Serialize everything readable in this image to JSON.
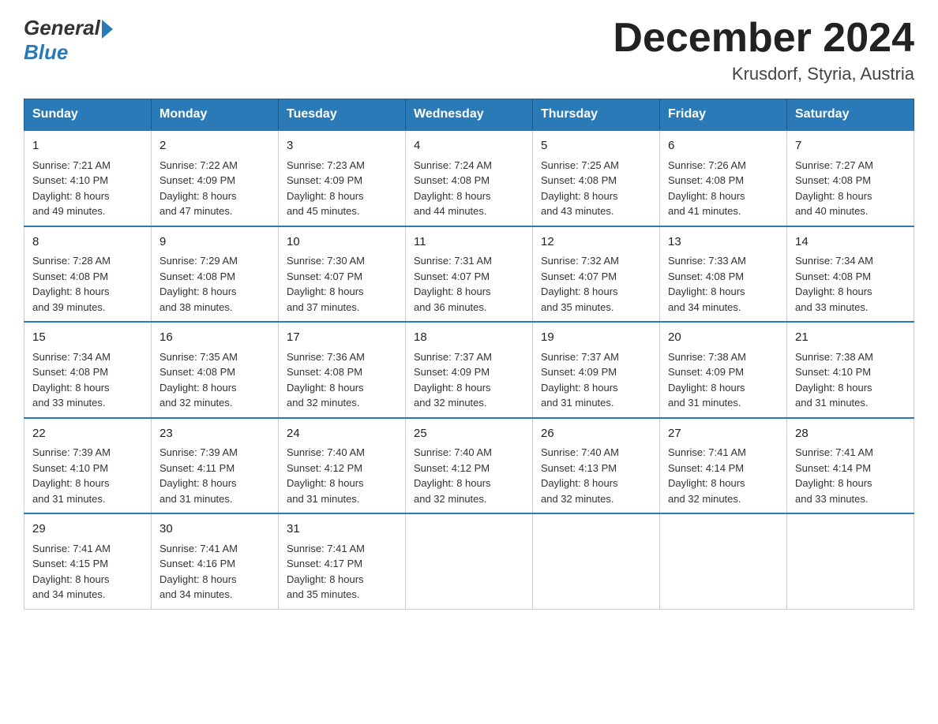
{
  "header": {
    "logo_general": "General",
    "logo_blue": "Blue",
    "month_title": "December 2024",
    "location": "Krusdorf, Styria, Austria"
  },
  "weekdays": [
    "Sunday",
    "Monday",
    "Tuesday",
    "Wednesday",
    "Thursday",
    "Friday",
    "Saturday"
  ],
  "weeks": [
    [
      {
        "day": "1",
        "sunrise": "7:21 AM",
        "sunset": "4:10 PM",
        "daylight": "8 hours and 49 minutes."
      },
      {
        "day": "2",
        "sunrise": "7:22 AM",
        "sunset": "4:09 PM",
        "daylight": "8 hours and 47 minutes."
      },
      {
        "day": "3",
        "sunrise": "7:23 AM",
        "sunset": "4:09 PM",
        "daylight": "8 hours and 45 minutes."
      },
      {
        "day": "4",
        "sunrise": "7:24 AM",
        "sunset": "4:08 PM",
        "daylight": "8 hours and 44 minutes."
      },
      {
        "day": "5",
        "sunrise": "7:25 AM",
        "sunset": "4:08 PM",
        "daylight": "8 hours and 43 minutes."
      },
      {
        "day": "6",
        "sunrise": "7:26 AM",
        "sunset": "4:08 PM",
        "daylight": "8 hours and 41 minutes."
      },
      {
        "day": "7",
        "sunrise": "7:27 AM",
        "sunset": "4:08 PM",
        "daylight": "8 hours and 40 minutes."
      }
    ],
    [
      {
        "day": "8",
        "sunrise": "7:28 AM",
        "sunset": "4:08 PM",
        "daylight": "8 hours and 39 minutes."
      },
      {
        "day": "9",
        "sunrise": "7:29 AM",
        "sunset": "4:08 PM",
        "daylight": "8 hours and 38 minutes."
      },
      {
        "day": "10",
        "sunrise": "7:30 AM",
        "sunset": "4:07 PM",
        "daylight": "8 hours and 37 minutes."
      },
      {
        "day": "11",
        "sunrise": "7:31 AM",
        "sunset": "4:07 PM",
        "daylight": "8 hours and 36 minutes."
      },
      {
        "day": "12",
        "sunrise": "7:32 AM",
        "sunset": "4:07 PM",
        "daylight": "8 hours and 35 minutes."
      },
      {
        "day": "13",
        "sunrise": "7:33 AM",
        "sunset": "4:08 PM",
        "daylight": "8 hours and 34 minutes."
      },
      {
        "day": "14",
        "sunrise": "7:34 AM",
        "sunset": "4:08 PM",
        "daylight": "8 hours and 33 minutes."
      }
    ],
    [
      {
        "day": "15",
        "sunrise": "7:34 AM",
        "sunset": "4:08 PM",
        "daylight": "8 hours and 33 minutes."
      },
      {
        "day": "16",
        "sunrise": "7:35 AM",
        "sunset": "4:08 PM",
        "daylight": "8 hours and 32 minutes."
      },
      {
        "day": "17",
        "sunrise": "7:36 AM",
        "sunset": "4:08 PM",
        "daylight": "8 hours and 32 minutes."
      },
      {
        "day": "18",
        "sunrise": "7:37 AM",
        "sunset": "4:09 PM",
        "daylight": "8 hours and 32 minutes."
      },
      {
        "day": "19",
        "sunrise": "7:37 AM",
        "sunset": "4:09 PM",
        "daylight": "8 hours and 31 minutes."
      },
      {
        "day": "20",
        "sunrise": "7:38 AM",
        "sunset": "4:09 PM",
        "daylight": "8 hours and 31 minutes."
      },
      {
        "day": "21",
        "sunrise": "7:38 AM",
        "sunset": "4:10 PM",
        "daylight": "8 hours and 31 minutes."
      }
    ],
    [
      {
        "day": "22",
        "sunrise": "7:39 AM",
        "sunset": "4:10 PM",
        "daylight": "8 hours and 31 minutes."
      },
      {
        "day": "23",
        "sunrise": "7:39 AM",
        "sunset": "4:11 PM",
        "daylight": "8 hours and 31 minutes."
      },
      {
        "day": "24",
        "sunrise": "7:40 AM",
        "sunset": "4:12 PM",
        "daylight": "8 hours and 31 minutes."
      },
      {
        "day": "25",
        "sunrise": "7:40 AM",
        "sunset": "4:12 PM",
        "daylight": "8 hours and 32 minutes."
      },
      {
        "day": "26",
        "sunrise": "7:40 AM",
        "sunset": "4:13 PM",
        "daylight": "8 hours and 32 minutes."
      },
      {
        "day": "27",
        "sunrise": "7:41 AM",
        "sunset": "4:14 PM",
        "daylight": "8 hours and 32 minutes."
      },
      {
        "day": "28",
        "sunrise": "7:41 AM",
        "sunset": "4:14 PM",
        "daylight": "8 hours and 33 minutes."
      }
    ],
    [
      {
        "day": "29",
        "sunrise": "7:41 AM",
        "sunset": "4:15 PM",
        "daylight": "8 hours and 34 minutes."
      },
      {
        "day": "30",
        "sunrise": "7:41 AM",
        "sunset": "4:16 PM",
        "daylight": "8 hours and 34 minutes."
      },
      {
        "day": "31",
        "sunrise": "7:41 AM",
        "sunset": "4:17 PM",
        "daylight": "8 hours and 35 minutes."
      },
      null,
      null,
      null,
      null
    ]
  ],
  "labels": {
    "sunrise": "Sunrise:",
    "sunset": "Sunset:",
    "daylight": "Daylight:"
  }
}
